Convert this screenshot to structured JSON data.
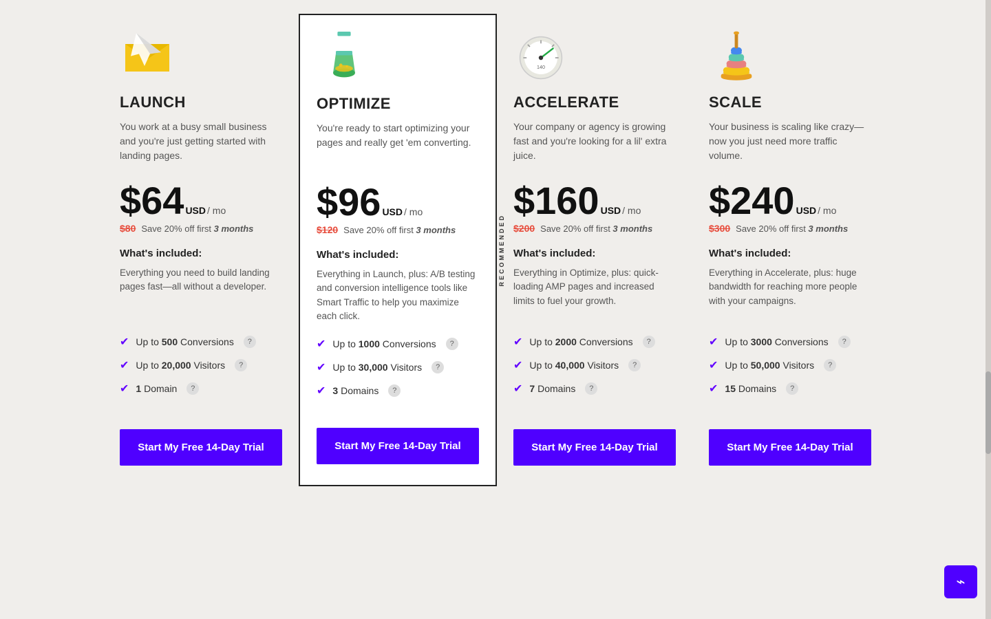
{
  "plans": [
    {
      "id": "launch",
      "name": "LAUNCH",
      "description": "You work at a busy small business and you're just getting started with landing pages.",
      "price": "$64",
      "currency": "USD",
      "period": "/ mo",
      "original_price": "$80",
      "savings_text": "Save 20% off first",
      "savings_months": "3 months",
      "whats_included": "What's included:",
      "included_description": "Everything you need to build landing pages fast—all without a developer.",
      "features": [
        {
          "text": "Up to ",
          "bold": "500",
          "suffix": " Conversions"
        },
        {
          "text": "Up to ",
          "bold": "20,000",
          "suffix": " Visitors"
        },
        {
          "text": "",
          "bold": "1",
          "suffix": " Domain"
        }
      ],
      "cta": "Start My Free 14-Day Trial",
      "recommended": false,
      "icon": "launch"
    },
    {
      "id": "optimize",
      "name": "OPTIMIZE",
      "description": "You're ready to start optimizing your pages and really get 'em converting.",
      "price": "$96",
      "currency": "USD",
      "period": "/ mo",
      "original_price": "$120",
      "savings_text": "Save 20% off first",
      "savings_months": "3 months",
      "whats_included": "What's included:",
      "included_description": "Everything in Launch, plus: A/B testing and conversion intelligence tools like Smart Traffic to help you maximize each click.",
      "features": [
        {
          "text": "Up to ",
          "bold": "1000",
          "suffix": " Conversions"
        },
        {
          "text": "Up to ",
          "bold": "30,000",
          "suffix": " Visitors"
        },
        {
          "text": "",
          "bold": "3",
          "suffix": " Domains"
        }
      ],
      "cta": "Start My Free 14-Day Trial",
      "recommended": true,
      "recommended_label": "RECOMMENDED",
      "icon": "optimize"
    },
    {
      "id": "accelerate",
      "name": "ACCELERATE",
      "description": "Your company or agency is growing fast and you're looking for a lil' extra juice.",
      "price": "$160",
      "currency": "USD",
      "period": "/ mo",
      "original_price": "$200",
      "savings_text": "Save 20% off first",
      "savings_months": "3 months",
      "whats_included": "What's included:",
      "included_description": "Everything in Optimize, plus: quick-loading AMP pages and increased limits to fuel your growth.",
      "features": [
        {
          "text": "Up to ",
          "bold": "2000",
          "suffix": " Conversions"
        },
        {
          "text": "Up to ",
          "bold": "40,000",
          "suffix": " Visitors"
        },
        {
          "text": "",
          "bold": "7",
          "suffix": " Domains"
        }
      ],
      "cta": "Start My Free 14-Day Trial",
      "recommended": false,
      "icon": "accelerate"
    },
    {
      "id": "scale",
      "name": "SCALE",
      "description": "Your business is scaling like crazy—now you just need more traffic volume.",
      "price": "$240",
      "currency": "USD",
      "period": "/ mo",
      "original_price": "$300",
      "savings_text": "Save 20% off first",
      "savings_months": "3 months",
      "whats_included": "What's included:",
      "included_description": "Everything in Accelerate, plus: huge bandwidth for reaching more people with your campaigns.",
      "features": [
        {
          "text": "Up to ",
          "bold": "3000",
          "suffix": " Conversions"
        },
        {
          "text": "Up to ",
          "bold": "50,000",
          "suffix": " Visitors"
        },
        {
          "text": "",
          "bold": "15",
          "suffix": " Domains"
        }
      ],
      "cta": "Start My Free 14-Day Trial",
      "recommended": false,
      "icon": "scale"
    }
  ],
  "chat": {
    "icon": "chat-icon"
  }
}
